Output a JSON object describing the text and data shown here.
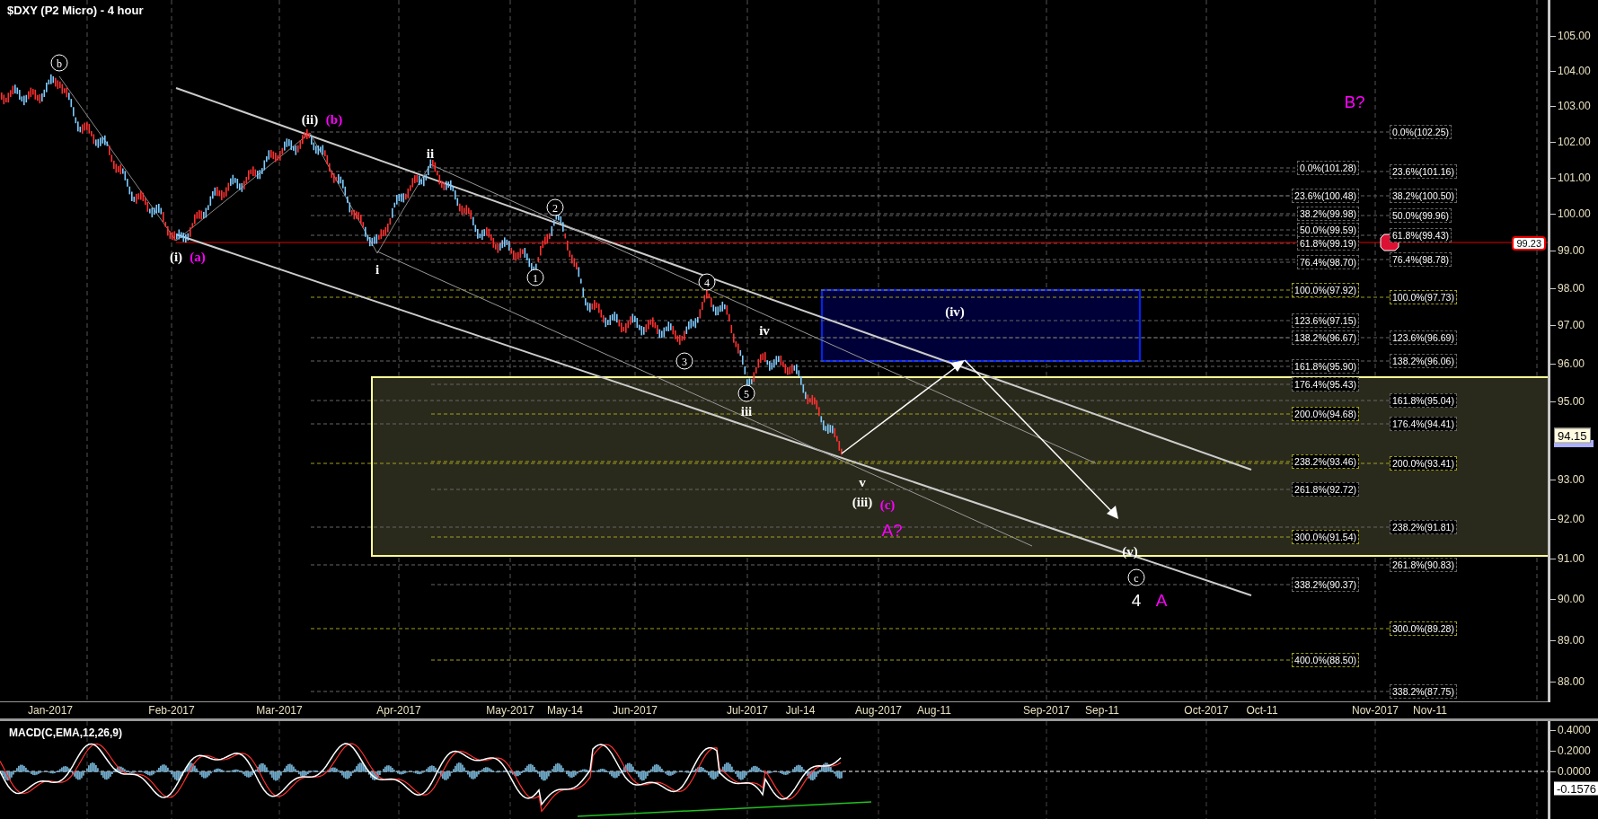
{
  "chart": {
    "title": "$DXY (P2 Micro) - 4 hour",
    "price_axis": [
      "105.00",
      "104.00",
      "103.00",
      "102.00",
      "101.00",
      "100.00",
      "99.00",
      "98.00",
      "97.00",
      "96.00",
      "95.00",
      "93.00",
      "92.00",
      "91.00",
      "90.00",
      "89.00",
      "88.00"
    ],
    "price_tags": [
      {
        "text": "99.23",
        "kind": "line"
      },
      {
        "text": "94.15",
        "kind": "last"
      }
    ],
    "wave_labels": [
      {
        "text": "b",
        "kind": "circled",
        "color": "#ffffff"
      },
      {
        "text": "(ii)",
        "kind": "plain",
        "color": "#ffffff"
      },
      {
        "text": "(b)",
        "kind": "plain",
        "color": "#ff00ff"
      },
      {
        "text": "ii",
        "kind": "plain",
        "color": "#ffffff"
      },
      {
        "text": "(i)",
        "kind": "plain",
        "color": "#ffffff"
      },
      {
        "text": "(a)",
        "kind": "plain",
        "color": "#ff00ff"
      },
      {
        "text": "i",
        "kind": "plain",
        "color": "#ffffff"
      },
      {
        "text": "2",
        "kind": "circled",
        "color": "#ffffff"
      },
      {
        "text": "1",
        "kind": "circled",
        "color": "#ffffff"
      },
      {
        "text": "4",
        "kind": "circled",
        "color": "#ffffff"
      },
      {
        "text": "3",
        "kind": "circled",
        "color": "#ffffff"
      },
      {
        "text": "iv",
        "kind": "plain",
        "color": "#ffffff"
      },
      {
        "text": "5",
        "kind": "circled",
        "color": "#ffffff"
      },
      {
        "text": "iii",
        "kind": "plain",
        "color": "#ffffff"
      },
      {
        "text": "(iv)",
        "kind": "plain",
        "color": "#ffffff"
      },
      {
        "text": "v",
        "kind": "plain",
        "color": "#ffffff"
      },
      {
        "text": "(iii)",
        "kind": "plain",
        "color": "#ffffff"
      },
      {
        "text": "(c)",
        "kind": "plain",
        "color": "#ff00ff"
      },
      {
        "text": "A?",
        "kind": "big",
        "color": "#ff00ff"
      },
      {
        "text": "(v)",
        "kind": "plain",
        "color": "#ffffff"
      },
      {
        "text": "c",
        "kind": "circled",
        "color": "#ffffff"
      },
      {
        "text": "4",
        "kind": "big",
        "color": "#ffffff"
      },
      {
        "text": "A",
        "kind": "big",
        "color": "#ff00ff"
      },
      {
        "text": "B?",
        "kind": "big",
        "color": "#ff00ff"
      }
    ],
    "fib_left": [
      {
        "text": "0.0%(101.28)",
        "color": "#666666"
      },
      {
        "text": "23.6%(100.48)",
        "color": "#666666"
      },
      {
        "text": "38.2%(99.98)",
        "color": "#666666"
      },
      {
        "text": "50.0%(99.59)",
        "color": "#666666"
      },
      {
        "text": "61.8%(99.19)",
        "color": "#666666"
      },
      {
        "text": "76.4%(98.70)",
        "color": "#666666"
      },
      {
        "text": "100.0%(97.92)",
        "color": "#a0a020"
      },
      {
        "text": "123.6%(97.15)",
        "color": "#666666"
      },
      {
        "text": "138.2%(96.67)",
        "color": "#666666"
      },
      {
        "text": "161.8%(95.90)",
        "color": "#666666"
      },
      {
        "text": "176.4%(95.43)",
        "color": "#666666"
      },
      {
        "text": "200.0%(94.68)",
        "color": "#a0a020"
      },
      {
        "text": "238.2%(93.46)",
        "color": "#a0a020"
      },
      {
        "text": "261.8%(92.72)",
        "color": "#666666"
      },
      {
        "text": "300.0%(91.54)",
        "color": "#a0a020"
      },
      {
        "text": "338.2%(90.37)",
        "color": "#666666"
      },
      {
        "text": "400.0%(88.50)",
        "color": "#a0a020"
      }
    ],
    "fib_right": [
      {
        "text": "0.0%(102.25)",
        "color": "#666666"
      },
      {
        "text": "23.6%(101.16)",
        "color": "#666666"
      },
      {
        "text": "38.2%(100.50)",
        "color": "#666666"
      },
      {
        "text": "50.0%(99.96)",
        "color": "#666666"
      },
      {
        "text": "61.8%(99.43)",
        "color": "#666666"
      },
      {
        "text": "76.4%(98.78)",
        "color": "#666666"
      },
      {
        "text": "100.0%(97.73)",
        "color": "#a0a020"
      },
      {
        "text": "123.6%(96.69)",
        "color": "#666666"
      },
      {
        "text": "138.2%(96.06)",
        "color": "#666666"
      },
      {
        "text": "161.8%(95.04)",
        "color": "#666666"
      },
      {
        "text": "176.4%(94.41)",
        "color": "#666666"
      },
      {
        "text": "200.0%(93.41)",
        "color": "#a0a020"
      },
      {
        "text": "238.2%(91.81)",
        "color": "#666666"
      },
      {
        "text": "261.8%(90.83)",
        "color": "#666666"
      },
      {
        "text": "300.0%(89.28)",
        "color": "#a0a020"
      },
      {
        "text": "338.2%(87.75)",
        "color": "#666666"
      }
    ],
    "date_axis": [
      "Jan-2017",
      "Feb-2017",
      "Mar-2017",
      "Apr-2017",
      "May-2017",
      "May-14",
      "Jun-2017",
      "Jul-2017",
      "Jul-14",
      "Aug-2017",
      "Aug-11",
      "Sep-2017",
      "Sep-11",
      "Oct-2017",
      "Oct-11",
      "Nov-2017",
      "Nov-11"
    ]
  },
  "macd": {
    "title": "MACD(C,EMA,12,26,9)",
    "axis": [
      "0.4000",
      "0.2000",
      "0.0000"
    ],
    "value_tag": "-0.1576"
  }
}
